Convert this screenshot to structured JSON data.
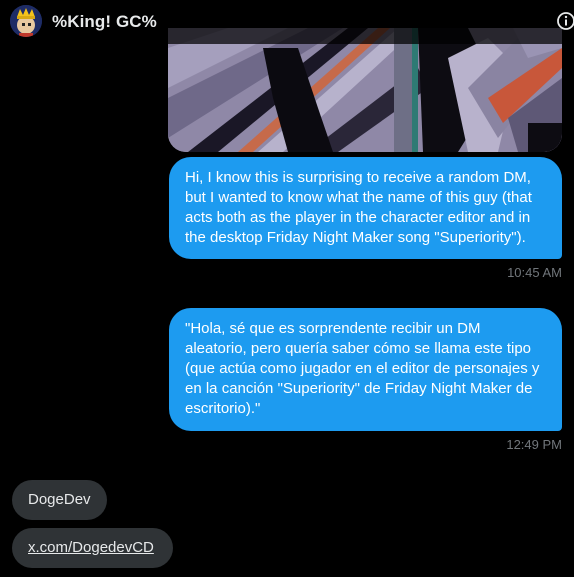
{
  "header": {
    "title": "%King! GC%",
    "avatar_icon": "crown-character-avatar",
    "info_icon": "info-circle-icon"
  },
  "messages": [
    {
      "kind": "image",
      "description_icon": "pixel-art-image"
    },
    {
      "kind": "sent",
      "text": "Hi, I know this is surprising to receive a random DM, but I wanted to know what the name of this guy (that acts both as the player in the character editor and in the desktop Friday Night Maker song \"Superiority\").",
      "time": "10:45 AM"
    },
    {
      "kind": "sent",
      "text": "\"Hola, sé que es sorprendente recibir un DM aleatorio, pero quería saber cómo se llama este tipo (que actúa como jugador en el editor de personajes y en la canción \"Superiority\" de Friday Night Maker de escritorio).\"",
      "time": "12:49 PM"
    },
    {
      "kind": "received",
      "text": "DogeDev"
    },
    {
      "kind": "received_link",
      "text": "x.com/DogedevCD"
    }
  ],
  "colors": {
    "sent_bubble": "#1d9bf0",
    "received_bubble": "#2f3336",
    "timestamp": "#71767b",
    "background": "#000000"
  }
}
